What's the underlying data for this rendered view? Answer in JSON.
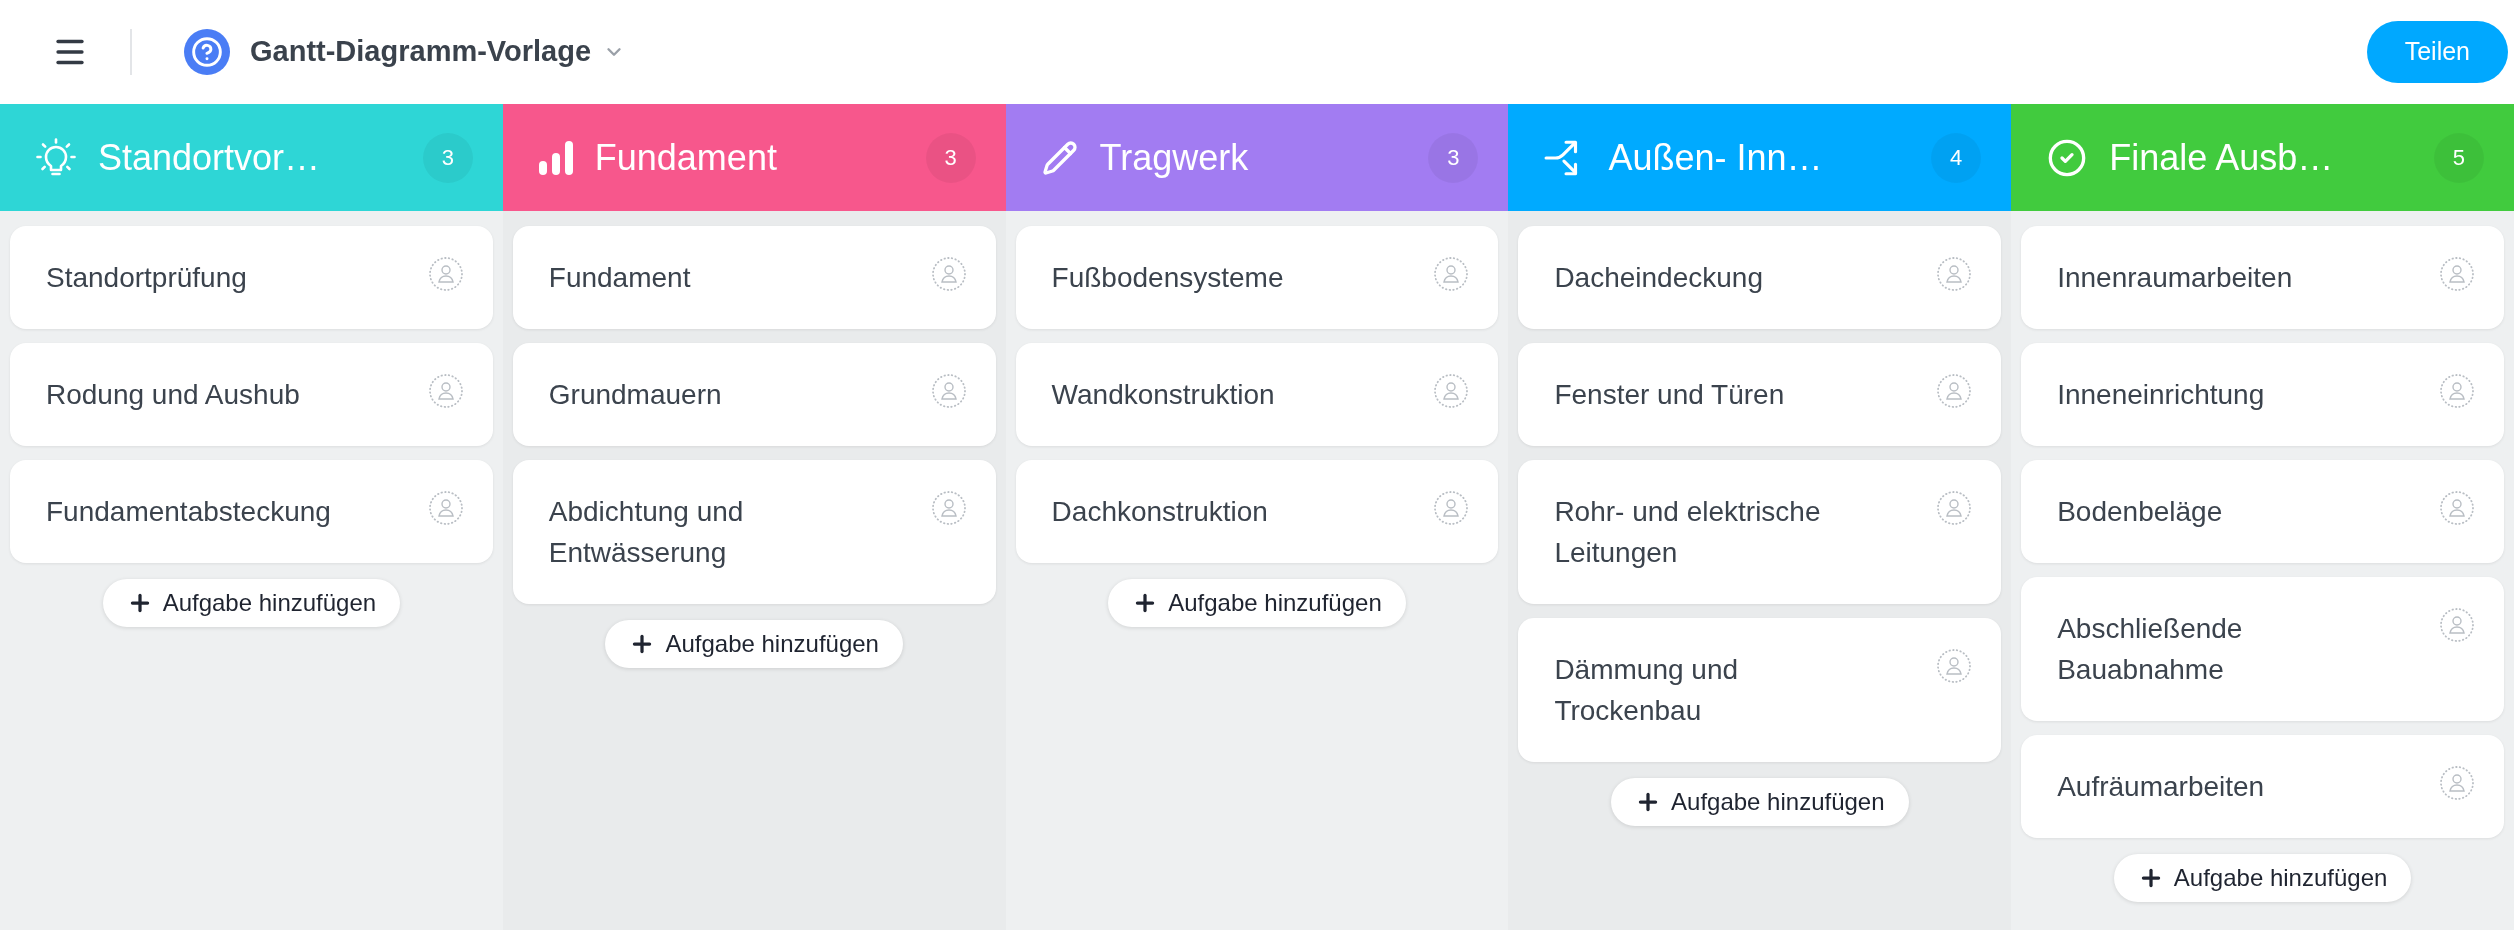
{
  "header": {
    "title": "Gantt-Diagramm-Vorlage",
    "share_button": "Teilen"
  },
  "columns": [
    {
      "title": "Standortvor…",
      "count": "3",
      "color": "#2ed6d6",
      "cards": [
        {
          "title": "Standortprüfung"
        },
        {
          "title": "Rodung und Aushub"
        },
        {
          "title": "Fundamentabsteckung"
        }
      ],
      "add_button": "Aufgabe hinzufügen"
    },
    {
      "title": "Fundament",
      "count": "3",
      "color": "#f7578c",
      "cards": [
        {
          "title": "Fundament"
        },
        {
          "title": "Grundmauern"
        },
        {
          "title": "Abdichtung und Entwässerung"
        }
      ],
      "add_button": "Aufgabe hinzufügen"
    },
    {
      "title": "Tragwerk",
      "count": "3",
      "color": "#a27cf2",
      "cards": [
        {
          "title": "Fußbodensysteme"
        },
        {
          "title": "Wandkonstruktion"
        },
        {
          "title": "Dachkonstruktion"
        }
      ],
      "add_button": "Aufgabe hinzufügen"
    },
    {
      "title": "Außen- Inn…",
      "count": "4",
      "color": "#00aaff",
      "cards": [
        {
          "title": "Dacheindeckung"
        },
        {
          "title": "Fenster und Türen"
        },
        {
          "title": "Rohr- und elektrische Leitungen"
        },
        {
          "title": "Dämmung und Trockenbau"
        }
      ],
      "add_button": "Aufgabe hinzufügen"
    },
    {
      "title": "Finale Ausb…",
      "count": "5",
      "color": "#41cb3e",
      "cards": [
        {
          "title": "Innenraumarbeiten"
        },
        {
          "title": "Inneneinrichtung"
        },
        {
          "title": "Bodenbeläge"
        },
        {
          "title": "Abschließende Bauabnahme"
        },
        {
          "title": "Aufräumarbeiten"
        }
      ],
      "add_button": "Aufgabe hinzufügen"
    }
  ]
}
